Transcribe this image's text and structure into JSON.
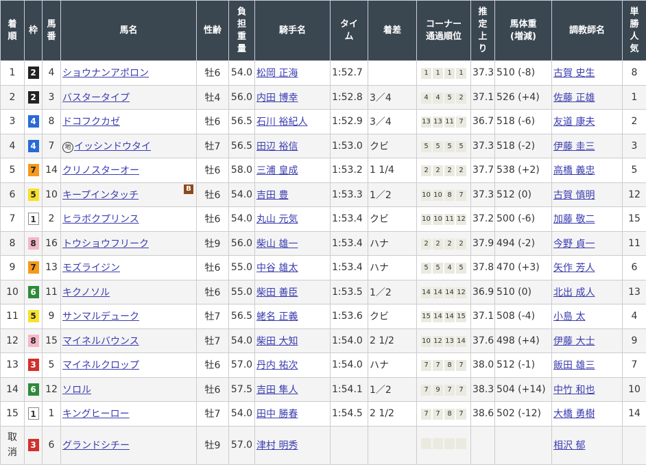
{
  "headers": {
    "rank": "着\n順",
    "waku": "枠",
    "num": "馬\n番",
    "horse": "馬名",
    "sex_age": "性齢",
    "weight": "負\n担\n重\n量",
    "jockey": "騎手名",
    "time": "タイ\nム",
    "margin": "着差",
    "corner": "コーナー\n通過順位",
    "last3f": "推\n定\n上\nり",
    "body": "馬体重\n(増減)",
    "trainer": "調教師名",
    "pop": "単\n勝\n人\n気"
  },
  "colors": {
    "header_bg": "#3a4650",
    "link": "#3a3bb0"
  },
  "rows": [
    {
      "rank": "1",
      "waku": "2",
      "num": "4",
      "horse": "ショウナンアポロン",
      "sex": "牡6",
      "wt": "54.0",
      "jockey": "松岡 正海",
      "time": "1:52.7",
      "margin": "",
      "corner": [
        "1",
        "1",
        "1",
        "1"
      ],
      "last": "37.3",
      "body": "510 (-8)",
      "trainer": "古賀 史生",
      "pop": "8"
    },
    {
      "rank": "2",
      "waku": "2",
      "num": "3",
      "horse": "バスタータイプ",
      "sex": "牡4",
      "wt": "56.0",
      "jockey": "内田 博幸",
      "time": "1:52.8",
      "margin": "3／4",
      "corner": [
        "4",
        "4",
        "5",
        "2"
      ],
      "last": "37.1",
      "body": "526 (+4)",
      "trainer": "佐藤 正雄",
      "pop": "1"
    },
    {
      "rank": "3",
      "waku": "4",
      "num": "8",
      "horse": "ドコフクカゼ",
      "sex": "牡6",
      "wt": "56.5",
      "jockey": "石川 裕紀人",
      "time": "1:52.9",
      "margin": "3／4",
      "corner": [
        "13",
        "13",
        "11",
        "7"
      ],
      "last": "36.7",
      "body": "518 (-6)",
      "trainer": "友道 康夫",
      "pop": "2"
    },
    {
      "rank": "4",
      "waku": "4",
      "num": "7",
      "horse": "イッシンドウタイ",
      "local": "地",
      "sex": "牡7",
      "wt": "56.5",
      "jockey": "田辺 裕信",
      "time": "1:53.0",
      "margin": "クビ",
      "corner": [
        "5",
        "5",
        "5",
        "5"
      ],
      "last": "37.3",
      "body": "518 (-2)",
      "trainer": "伊藤 圭三",
      "pop": "3"
    },
    {
      "rank": "5",
      "waku": "7",
      "num": "14",
      "horse": "クリノスターオー",
      "sex": "牡6",
      "wt": "58.0",
      "jockey": "三浦 皇成",
      "time": "1:53.2",
      "margin": "1 1/4",
      "corner": [
        "2",
        "2",
        "2",
        "2"
      ],
      "last": "37.7",
      "body": "538 (+2)",
      "trainer": "高橋 義忠",
      "pop": "5"
    },
    {
      "rank": "6",
      "waku": "5",
      "num": "10",
      "horse": "キープインタッチ",
      "blinker": "B",
      "sex": "牡6",
      "wt": "54.0",
      "jockey": "吉田 豊",
      "time": "1:53.3",
      "margin": "1／2",
      "corner": [
        "10",
        "10",
        "8",
        "7"
      ],
      "last": "37.3",
      "body": "512 (0)",
      "trainer": "古賀 慎明",
      "pop": "12"
    },
    {
      "rank": "7",
      "waku": "1",
      "num": "2",
      "horse": "ヒラボクプリンス",
      "sex": "牡6",
      "wt": "54.0",
      "jockey": "丸山 元気",
      "time": "1:53.4",
      "margin": "クビ",
      "corner": [
        "10",
        "10",
        "11",
        "12"
      ],
      "last": "37.2",
      "body": "500 (-6)",
      "trainer": "加藤 敬二",
      "pop": "15"
    },
    {
      "rank": "8",
      "waku": "8",
      "num": "16",
      "horse": "トウショウフリーク",
      "sex": "牡9",
      "wt": "56.0",
      "jockey": "柴山 雄一",
      "time": "1:53.4",
      "margin": "ハナ",
      "corner": [
        "2",
        "2",
        "2",
        "2"
      ],
      "last": "37.9",
      "body": "494 (-2)",
      "trainer": "今野 貞一",
      "pop": "11"
    },
    {
      "rank": "9",
      "waku": "7",
      "num": "13",
      "horse": "モズライジン",
      "sex": "牡6",
      "wt": "55.0",
      "jockey": "中谷 雄太",
      "time": "1:53.4",
      "margin": "ハナ",
      "corner": [
        "5",
        "5",
        "4",
        "5"
      ],
      "last": "37.8",
      "body": "470 (+3)",
      "trainer": "矢作 芳人",
      "pop": "6"
    },
    {
      "rank": "10",
      "waku": "6",
      "num": "11",
      "horse": "キクノソル",
      "sex": "牡6",
      "wt": "55.0",
      "jockey": "柴田 善臣",
      "time": "1:53.5",
      "margin": "1／2",
      "corner": [
        "14",
        "14",
        "14",
        "12"
      ],
      "last": "36.9",
      "body": "510 (0)",
      "trainer": "北出 成人",
      "pop": "13"
    },
    {
      "rank": "11",
      "waku": "5",
      "num": "9",
      "horse": "サンマルデューク",
      "sex": "牡7",
      "wt": "56.5",
      "jockey": "蛯名 正義",
      "time": "1:53.6",
      "margin": "クビ",
      "corner": [
        "15",
        "14",
        "14",
        "15"
      ],
      "last": "37.1",
      "body": "508 (-4)",
      "trainer": "小島 太",
      "pop": "4"
    },
    {
      "rank": "12",
      "waku": "8",
      "num": "15",
      "horse": "マイネルバウンス",
      "sex": "牡7",
      "wt": "54.0",
      "jockey": "柴田 大知",
      "time": "1:54.0",
      "margin": "2 1/2",
      "corner": [
        "10",
        "12",
        "13",
        "14"
      ],
      "last": "37.6",
      "body": "498 (+4)",
      "trainer": "伊藤 大士",
      "pop": "9"
    },
    {
      "rank": "13",
      "waku": "3",
      "num": "5",
      "horse": "マイネルクロップ",
      "sex": "牡6",
      "wt": "57.0",
      "jockey": "丹内 祐次",
      "time": "1:54.0",
      "margin": "ハナ",
      "corner": [
        "7",
        "7",
        "8",
        "7"
      ],
      "last": "38.0",
      "body": "512 (-1)",
      "trainer": "飯田 雄三",
      "pop": "7"
    },
    {
      "rank": "14",
      "waku": "6",
      "num": "12",
      "horse": "ソロル",
      "sex": "牡6",
      "wt": "57.5",
      "jockey": "吉田 隼人",
      "time": "1:54.1",
      "margin": "1／2",
      "corner": [
        "7",
        "9",
        "7",
        "7"
      ],
      "last": "38.3",
      "body": "504 (+14)",
      "trainer": "中竹 和也",
      "pop": "10"
    },
    {
      "rank": "15",
      "waku": "1",
      "num": "1",
      "horse": "キングヒーロー",
      "sex": "牡7",
      "wt": "54.0",
      "jockey": "田中 勝春",
      "time": "1:54.5",
      "margin": "2 1/2",
      "corner": [
        "7",
        "7",
        "8",
        "7"
      ],
      "last": "38.6",
      "body": "502 (-12)",
      "trainer": "大橋 勇樹",
      "pop": "14"
    },
    {
      "rank": "取\n消",
      "waku": "3",
      "num": "6",
      "horse": "グランドシチー",
      "sex": "牡9",
      "wt": "57.0",
      "jockey": "津村 明秀",
      "time": "",
      "margin": "",
      "corner": [
        "",
        "",
        "",
        ""
      ],
      "last": "",
      "body": "",
      "trainer": "相沢 郁",
      "pop": ""
    }
  ]
}
